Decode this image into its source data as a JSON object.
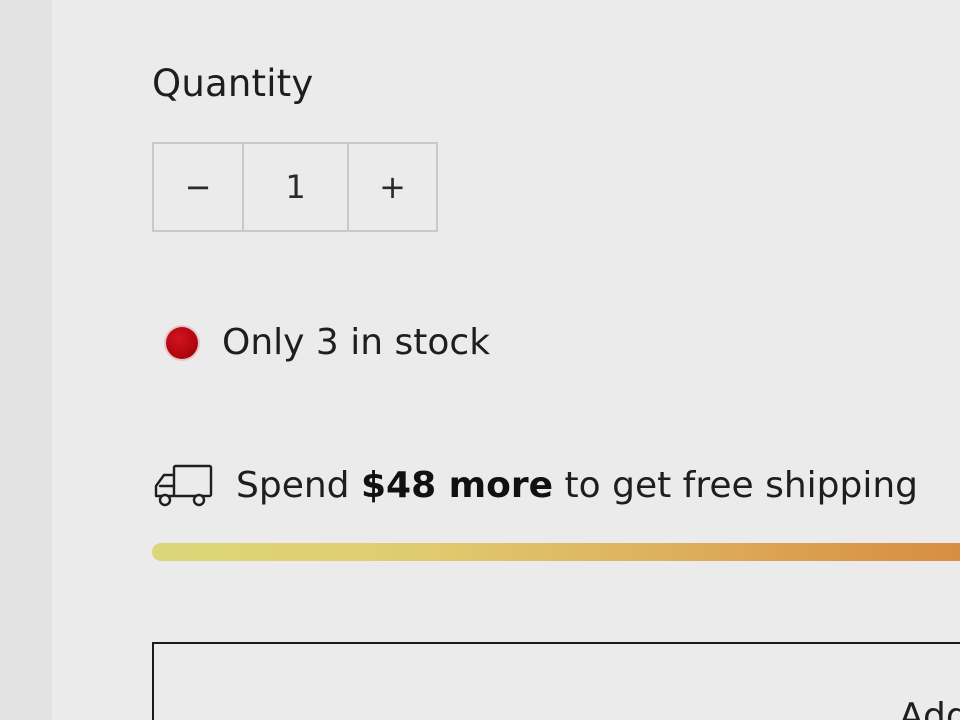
{
  "quantity": {
    "label": "Quantity",
    "decrement_label": "−",
    "value": "1",
    "increment_label": "+"
  },
  "stock": {
    "text": "Only 3 in stock",
    "indicator_color": "#b50610"
  },
  "shipping": {
    "icon": "truck-icon",
    "text_before": "Spend ",
    "amount_text": "$48 more",
    "text_after": " to get free shipping",
    "progress_gradient": [
      "#dcd67a",
      "#d58a40"
    ]
  },
  "cart": {
    "button_label_visible": "Add"
  }
}
